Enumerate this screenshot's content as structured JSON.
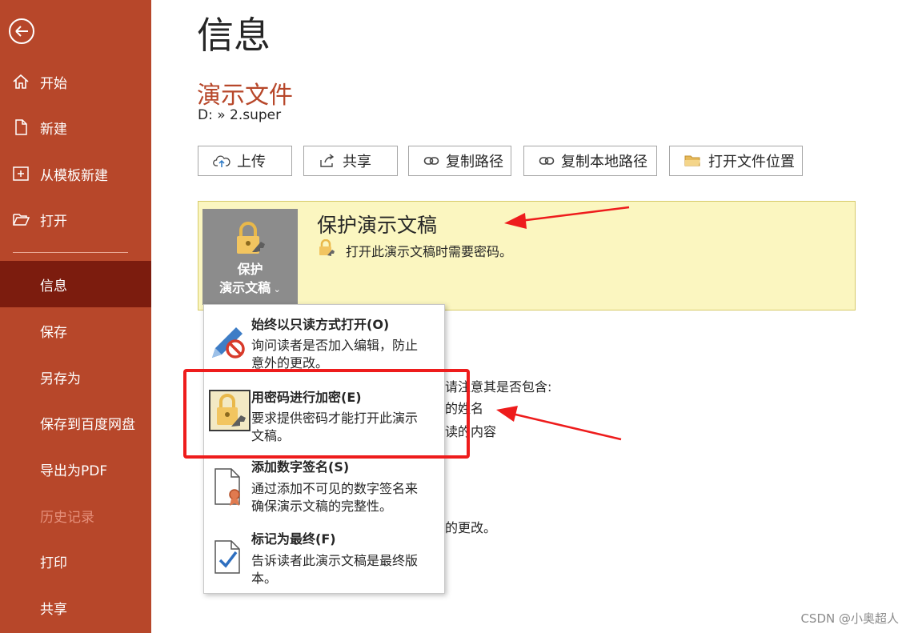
{
  "sidebar": {
    "items": [
      {
        "label": "开始",
        "icon": "home-icon"
      },
      {
        "label": "新建",
        "icon": "new-doc-icon"
      },
      {
        "label": "从模板新建",
        "icon": "template-icon"
      },
      {
        "label": "打开",
        "icon": "folder-open-icon"
      },
      {
        "label": "信息",
        "active": true
      },
      {
        "label": "保存"
      },
      {
        "label": "另存为"
      },
      {
        "label": "保存到百度网盘"
      },
      {
        "label": "导出为PDF"
      },
      {
        "label": "历史记录",
        "disabled": true
      },
      {
        "label": "打印"
      },
      {
        "label": "共享"
      }
    ]
  },
  "main": {
    "page_title": "信息",
    "doc_title": "演示文件",
    "doc_path": "D: » 2.super",
    "toolbar": [
      {
        "label": "上传",
        "icon": "cloud-upload-icon"
      },
      {
        "label": "共享",
        "icon": "share-icon"
      },
      {
        "label": "复制路径",
        "icon": "link-icon"
      },
      {
        "label": "复制本地路径",
        "icon": "link-icon"
      },
      {
        "label": "打开文件位置",
        "icon": "folder-icon"
      }
    ],
    "protect": {
      "tile_line1": "保护",
      "tile_line2": "演示文稿",
      "heading": "保护演示文稿",
      "description": "打开此演示文稿时需要密码。"
    },
    "behind_text": {
      "line1": "请注意其是否包含:",
      "line2": "的姓名",
      "line3": "读的内容",
      "line4": "的更改。"
    }
  },
  "dropdown": {
    "items": [
      {
        "title": "始终以只读方式打开(O)",
        "desc": "询问读者是否加入编辑，防止意外的更改。",
        "icon": "pencil-no-icon"
      },
      {
        "title": "用密码进行加密(E)",
        "desc": "要求提供密码才能打开此演示文稿。",
        "icon": "lock-key-icon"
      },
      {
        "title": "添加数字签名(S)",
        "desc": "通过添加不可见的数字签名来确保演示文稿的完整性。",
        "icon": "signature-ribbon-icon"
      },
      {
        "title": "标记为最终(F)",
        "desc": "告诉读者此演示文稿是最终版本。",
        "icon": "document-check-icon"
      }
    ]
  },
  "watermark": "CSDN @小奥超人",
  "colors": {
    "sidebar": "#b7472a",
    "active": "#7c1c0e",
    "panel": "#fbf6c0",
    "annotation": "#ee1c1c"
  }
}
